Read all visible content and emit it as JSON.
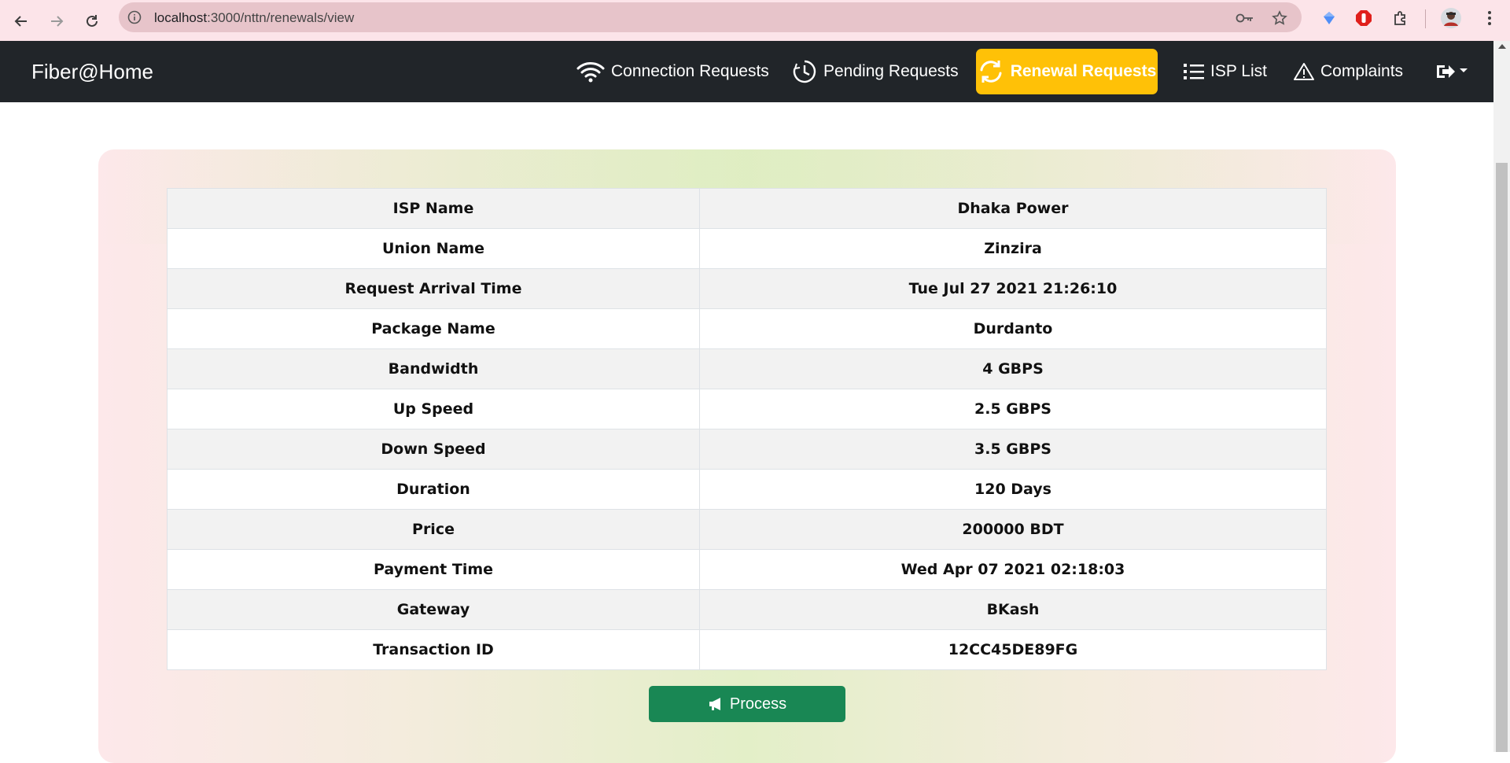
{
  "browser": {
    "url_host": "localhost",
    "url_path": ":3000/nttn/renewals/view"
  },
  "navbar": {
    "brand": "Fiber@Home",
    "items": [
      {
        "label": "Connection Requests",
        "icon": "wifi-icon"
      },
      {
        "label": "Pending Requests",
        "icon": "clock-history-icon"
      },
      {
        "label": "Renewal Requests",
        "icon": "refresh-icon",
        "active": true
      },
      {
        "label": "ISP List",
        "icon": "list-icon"
      },
      {
        "label": "Complaints",
        "icon": "warning-triangle-icon"
      }
    ],
    "logout_icon": "logout-dropdown-icon",
    "active_color": "#ffc107",
    "background": "#212529"
  },
  "details": {
    "rows": [
      {
        "label": "ISP Name",
        "value": "Dhaka Power"
      },
      {
        "label": "Union Name",
        "value": "Zinzira"
      },
      {
        "label": "Request Arrival Time",
        "value": "Tue Jul 27 2021 21:26:10"
      },
      {
        "label": "Package Name",
        "value": "Durdanto"
      },
      {
        "label": "Bandwidth",
        "value": "4 GBPS"
      },
      {
        "label": "Up Speed",
        "value": "2.5 GBPS"
      },
      {
        "label": "Down Speed",
        "value": "3.5 GBPS"
      },
      {
        "label": "Duration",
        "value": "120 Days"
      },
      {
        "label": "Price",
        "value": "200000 BDT"
      },
      {
        "label": "Payment Time",
        "value": "Wed Apr 07 2021 02:18:03"
      },
      {
        "label": "Gateway",
        "value": "BKash"
      },
      {
        "label": "Transaction ID",
        "value": "12CC45DE89FG"
      }
    ]
  },
  "actions": {
    "process_label": "Process",
    "process_icon": "megaphone-icon",
    "process_color": "#198754"
  }
}
